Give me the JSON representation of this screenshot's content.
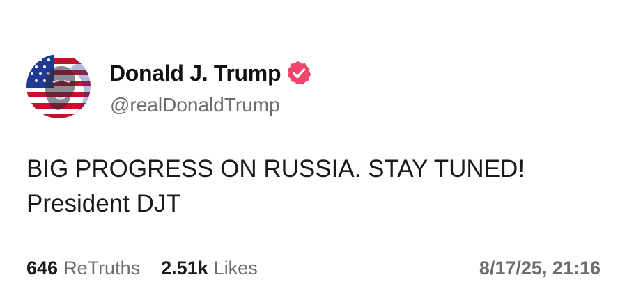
{
  "author": {
    "display_name": "Donald J. Trump",
    "handle": "@realDonaldTrump",
    "verified": true,
    "avatar_icon": "flag-portrait-avatar",
    "badge_icon": "verified-badge-icon",
    "badge_color": "#f0466e"
  },
  "post": {
    "lines": [
      "BIG PROGRESS ON RUSSIA. STAY TUNED!",
      "President DJT"
    ]
  },
  "stats": {
    "retruths_count": "646",
    "retruths_label": "ReTruths",
    "likes_count": "2.51k",
    "likes_label": "Likes"
  },
  "timestamp": "8/17/25, 21:16",
  "colors": {
    "text_primary": "#1a1a1a",
    "text_secondary": "#6b6b72",
    "flag_red": "#c8102e",
    "flag_blue": "#1f3a93"
  }
}
